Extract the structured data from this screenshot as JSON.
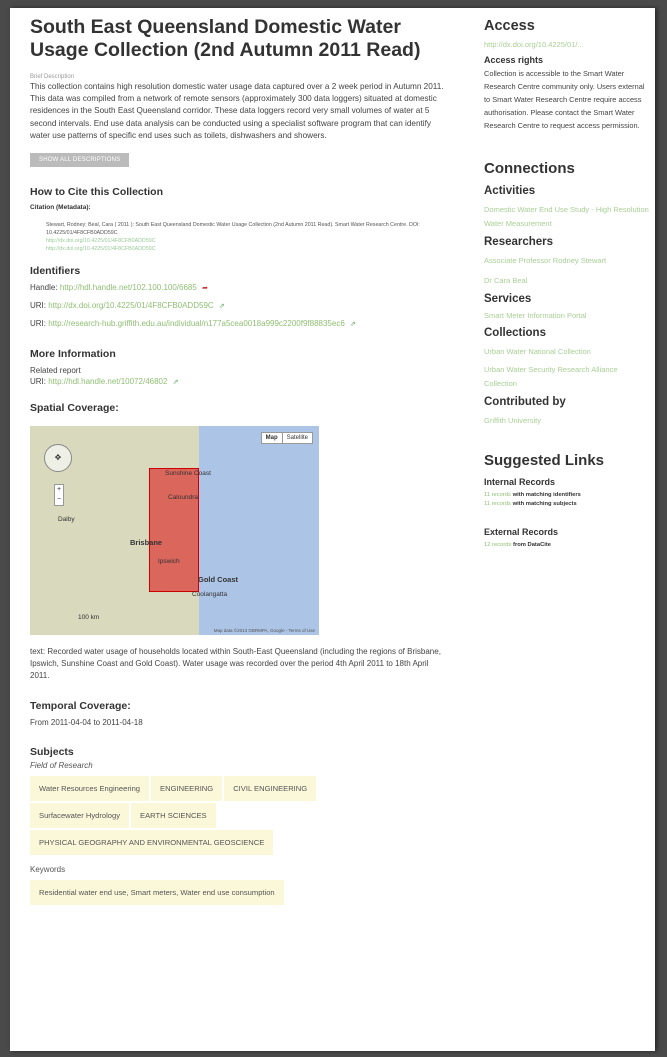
{
  "title": "South East Queensland Domestic Water Usage Collection (2nd Autumn 2011 Read)",
  "brief_label": "Brief Description",
  "description": "This collection contains high resolution domestic water usage data captured over a 2 week period in Autumn 2011. This data was compiled from a network of remote sensors (approximately 300 data loggers) situated at domestic residences in the South East Queensland corridor. These data loggers record very small volumes of water at 5 second intervals. End use data analysis can be conducted using a specialist software program that can identify water use patterns of specific end uses such as toilets, dishwashers and showers.",
  "show_all_button": "SHOW ALL DESCRIPTIONS",
  "cite": {
    "heading": "How to Cite this Collection",
    "label": "Citation (Metadata):",
    "text": "Stewart, Rodney; Beal, Cara ( 2011 ): South East Queensland Domestic Water Usage Collection (2nd Autumn 2011 Read). Smart Water Research Centre. DOI: 10.4225/01/4F8CFB0ADD59C",
    "link1": "http://dx.doi.org/10.4225/01/4F8CFB0ADD59C",
    "link2": "http://dx.doi.org/10.4225/01/4F8CFB0ADD59C"
  },
  "identifiers": {
    "heading": "Identifiers",
    "handle_label": "Handle:",
    "handle": "http://hdl.handle.net/102.100.100/6685",
    "uri1_label": "URI:",
    "uri1": "http://dx.doi.org/10.4225/01/4F8CFB0ADD59C",
    "uri2_label": "URI:",
    "uri2": "http://research-hub.griffith.edu.au/individual/n177a5cea0018a999c2200f9f88835ec6"
  },
  "more_info": {
    "heading": "More Information",
    "related": "Related report",
    "uri_label": "URI:",
    "uri": "http://hdl.handle.net/10072/46802"
  },
  "spatial": {
    "heading": "Spatial Coverage:",
    "map_btn": "Map",
    "sat_btn": "Satellite",
    "labels": [
      "Sunshine Coast",
      "Caloundra",
      "Dalby",
      "Brisbane",
      "Ipswich",
      "Gold Coast",
      "Coolangatta",
      "100 km"
    ],
    "legal": "Map data ©2013 GBRMPA, Google - Terms of Use",
    "text": "text: Recorded water usage of households located within South-East Queensland (including the regions of Brisbane, Ipswich, Sunshine Coast and Gold Coast). Water usage was recorded over the period 4th April 2011 to 18th April 2011."
  },
  "temporal": {
    "heading": "Temporal Coverage:",
    "text": "From 2011-04-04 to 2011-04-18"
  },
  "subjects": {
    "heading": "Subjects",
    "field_label": "Field of Research",
    "rows": [
      [
        "Water Resources Engineering",
        "ENGINEERING",
        "CIVIL ENGINEERING"
      ],
      [
        "Surfacewater Hydrology",
        "EARTH SCIENCES"
      ],
      [
        "PHYSICAL GEOGRAPHY AND ENVIRONMENTAL GEOSCIENCE"
      ]
    ],
    "keywords_label": "Keywords",
    "keywords": "Residential water end use, Smart meters, Water end use consumption"
  },
  "sidebar": {
    "access_heading": "Access",
    "access_link": "http://dx.doi.org/10.4225/01/...",
    "rights_heading": "Access rights",
    "rights_text": "Collection is accessible to the Smart Water Research Centre community only. Users external to Smart Water Research Centre require access authorisation. Please contact the Smart Water Research Centre to request access permission.",
    "connections_heading": "Connections",
    "activities_heading": "Activities",
    "activities": [
      "Domestic Water End Use Study - High Resolution Water Measurement"
    ],
    "researchers_heading": "Researchers",
    "researchers": [
      "Associate Professor Rodney Stewart",
      "Dr Cara Beal"
    ],
    "services_heading": "Services",
    "services": [
      "Smart Meter Information Portal"
    ],
    "collections_heading": "Collections",
    "collections": [
      "Urban Water National Collection",
      "Urban Water Security Research Alliance Collection"
    ],
    "contributed_heading": "Contributed by",
    "contributed": "Griffith University",
    "suggested_heading": "Suggested Links",
    "internal_heading": "Internal Records",
    "internal": [
      {
        "count": "11 records",
        "text": "with matching identifiers"
      },
      {
        "count": "11 records",
        "text": "with matching subjects"
      }
    ],
    "external_heading": "External Records",
    "external": {
      "count": "12 records",
      "text": "from DataCite"
    }
  }
}
